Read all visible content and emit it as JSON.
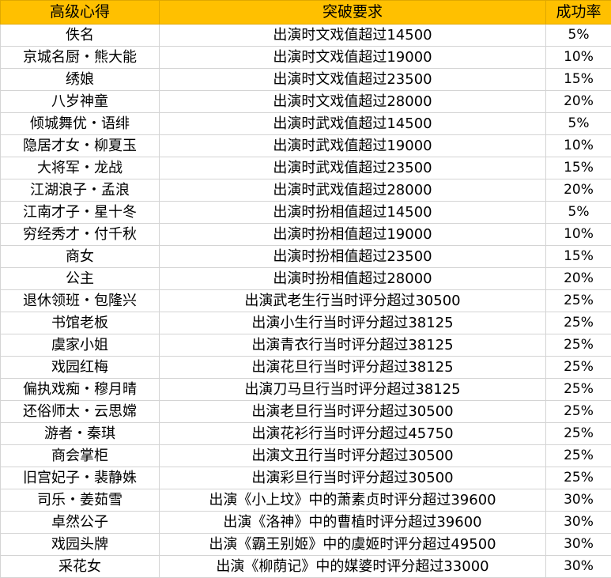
{
  "header_bg": "#ffc000",
  "headers": {
    "name": "高级心得",
    "requirement": "突破要求",
    "rate": "成功率"
  },
  "rows": [
    {
      "name": "佚名",
      "requirement": "出演时文戏值超过14500",
      "rate": "5%"
    },
    {
      "name": "京城名厨・熊大能",
      "requirement": "出演时文戏值超过19000",
      "rate": "10%"
    },
    {
      "name": "绣娘",
      "requirement": "出演时文戏值超过23500",
      "rate": "15%"
    },
    {
      "name": "八岁神童",
      "requirement": "出演时文戏值超过28000",
      "rate": "20%"
    },
    {
      "name": "倾城舞优・语绯",
      "requirement": "出演时武戏值超过14500",
      "rate": "5%"
    },
    {
      "name": "隐居才女・柳夏玉",
      "requirement": "出演时武戏值超过19000",
      "rate": "10%"
    },
    {
      "name": "大将军・龙战",
      "requirement": "出演时武戏值超过23500",
      "rate": "15%"
    },
    {
      "name": "江湖浪子・孟浪",
      "requirement": "出演时武戏值超过28000",
      "rate": "20%"
    },
    {
      "name": "江南才子・星十冬",
      "requirement": "出演时扮相值超过14500",
      "rate": "5%"
    },
    {
      "name": "穷经秀才・付千秋",
      "requirement": "出演时扮相值超过19000",
      "rate": "10%"
    },
    {
      "name": "商女",
      "requirement": "出演时扮相值超过23500",
      "rate": "15%"
    },
    {
      "name": "公主",
      "requirement": "出演时扮相值超过28000",
      "rate": "20%"
    },
    {
      "name": "退休领班・包隆兴",
      "requirement": "出演武老生行当时评分超过30500",
      "rate": "25%"
    },
    {
      "name": "书馆老板",
      "requirement": "出演小生行当时评分超过38125",
      "rate": "25%"
    },
    {
      "name": "虞家小姐",
      "requirement": "出演青衣行当时评分超过38125",
      "rate": "25%"
    },
    {
      "name": "戏园红梅",
      "requirement": "出演花旦行当时评分超过38125",
      "rate": "25%"
    },
    {
      "name": "偏执戏痴・穆月晴",
      "requirement": "出演刀马旦行当时评分超过38125",
      "rate": "25%"
    },
    {
      "name": "还俗师太・云思嫦",
      "requirement": "出演老旦行当时评分超过30500",
      "rate": "25%"
    },
    {
      "name": "游者・秦琪",
      "requirement": "出演花衫行当时评分超过45750",
      "rate": "25%"
    },
    {
      "name": "商会掌柜",
      "requirement": "出演文丑行当时评分超过30500",
      "rate": "25%"
    },
    {
      "name": "旧宫妃子・裴静姝",
      "requirement": "出演彩旦行当时评分超过30500",
      "rate": "25%"
    },
    {
      "name": "司乐・姜茹雪",
      "requirement": "出演《小上坟》中的萧素贞时评分超过39600",
      "rate": "30%"
    },
    {
      "name": "卓然公子",
      "requirement": "出演《洛神》中的曹植时评分超过39600",
      "rate": "30%"
    },
    {
      "name": "戏园头牌",
      "requirement": "出演《霸王别姬》中的虞姬时评分超过49500",
      "rate": "30%"
    },
    {
      "name": "采花女",
      "requirement": "出演《柳荫记》中的媒婆时评分超过33000",
      "rate": "30%"
    }
  ]
}
